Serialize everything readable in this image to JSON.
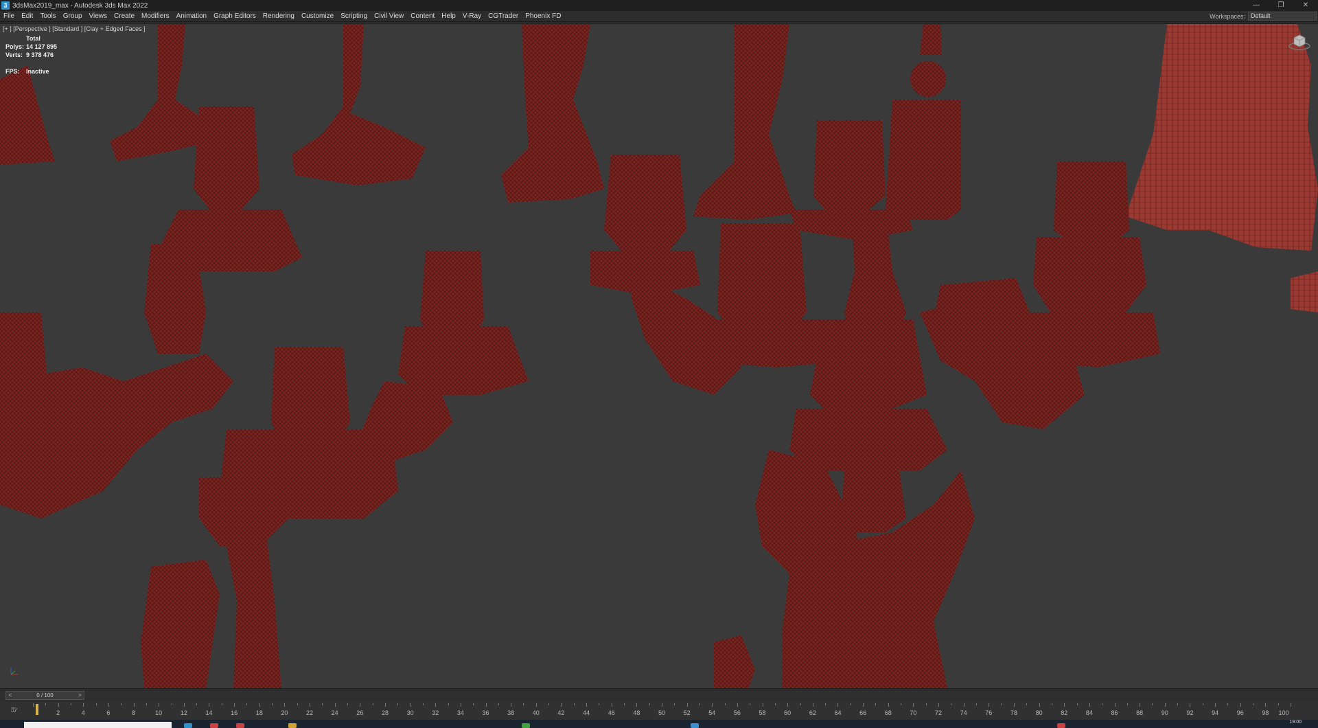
{
  "window": {
    "title": "3dsMax2019_max - Autodesk 3ds Max 2022",
    "app_icon": "3",
    "controls": [
      "—",
      "❐",
      "✕"
    ]
  },
  "menu": {
    "items": [
      "File",
      "Edit",
      "Tools",
      "Group",
      "Views",
      "Create",
      "Modifiers",
      "Animation",
      "Graph Editors",
      "Rendering",
      "Customize",
      "Scripting",
      "Civil View",
      "Content",
      "Help",
      "V-Ray",
      "CGTrader",
      "Phoenix FD"
    ]
  },
  "workspace": {
    "label": "Workspaces:",
    "value": "Default"
  },
  "viewport": {
    "label": "[+ ] [Perspective ] [Standard ] [Clay + Edged Faces ]",
    "stats": {
      "total_label": "Total",
      "polys_label": "Polys:",
      "polys_value": "14 127 895",
      "verts_label": "Verts:",
      "verts_value": "9 378 476",
      "fps_label": "FPS:",
      "fps_value": "Inactive"
    },
    "mesh_color": "#7a2420",
    "background_color": "#3a3a3a"
  },
  "time_slider": {
    "value": "0 / 100",
    "prev": "<",
    "next": ">"
  },
  "trackbar": {
    "labels": [
      "2",
      "4",
      "6",
      "8",
      "10",
      "12",
      "14",
      "16",
      "18",
      "20",
      "22",
      "24",
      "26",
      "28",
      "30",
      "32",
      "34",
      "36",
      "38",
      "40",
      "42",
      "44",
      "46",
      "48",
      "50",
      "52",
      "54",
      "56",
      "58",
      "60",
      "62",
      "64",
      "66",
      "68",
      "70",
      "72",
      "74",
      "76",
      "78",
      "80",
      "82",
      "84",
      "86",
      "88",
      "90",
      "92",
      "94",
      "96",
      "98",
      "100"
    ],
    "key_label": "⚿∕"
  },
  "taskbar": {
    "clock": "19:00"
  }
}
